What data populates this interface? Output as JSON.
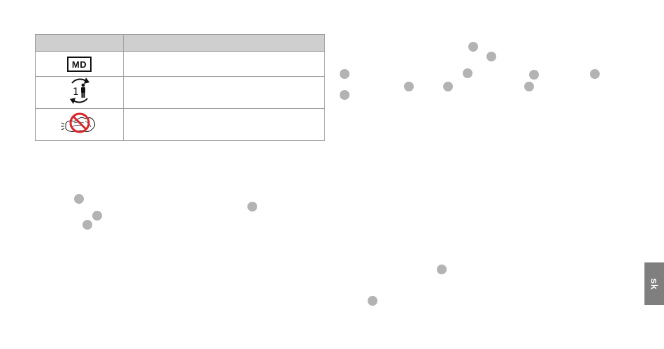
{
  "symbol_table": {
    "header": [
      "",
      ""
    ],
    "rows": [
      {
        "icon": "medical-device-icon",
        "symbol_text": "MD",
        "description": ""
      },
      {
        "icon": "single-patient-multiple-use-icon",
        "symbol_text": "1",
        "description": ""
      },
      {
        "icon": "do-not-put-in-washing-machine-icon",
        "symbol_text": "",
        "description": ""
      }
    ]
  },
  "language_tab": {
    "label": "sk"
  },
  "colors": {
    "callout_dot": "#b3b3b3",
    "tab_background": "#7f7f7f",
    "table_header": "#cfcfcf",
    "prohibition_red": "#d7262c"
  }
}
